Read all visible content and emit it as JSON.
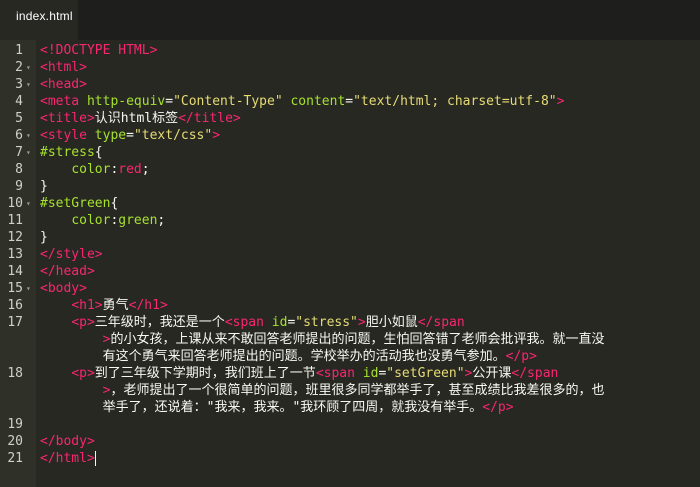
{
  "tab": {
    "title": "index.html"
  },
  "lines": [
    {
      "n": "1",
      "fold": false,
      "parts": [
        [
          "t",
          "<!DOCTYPE HTML>"
        ]
      ]
    },
    {
      "n": "2",
      "fold": true,
      "parts": [
        [
          "t",
          "<html>"
        ]
      ]
    },
    {
      "n": "3",
      "fold": true,
      "parts": [
        [
          "t",
          "<head>"
        ]
      ]
    },
    {
      "n": "4",
      "fold": false,
      "parts": [
        [
          "t",
          "<meta "
        ],
        [
          "a",
          "http-equiv"
        ],
        [
          "w",
          "="
        ],
        [
          "s",
          "\"Content-Type\""
        ],
        [
          "w",
          " "
        ],
        [
          "a",
          "content"
        ],
        [
          "w",
          "="
        ],
        [
          "s",
          "\"text/html; charset=utf-8\""
        ],
        [
          "t",
          ">"
        ]
      ]
    },
    {
      "n": "5",
      "fold": false,
      "parts": [
        [
          "t",
          "<title>"
        ],
        [
          "w",
          "认识html标签"
        ],
        [
          "t",
          "</title>"
        ]
      ]
    },
    {
      "n": "6",
      "fold": true,
      "parts": [
        [
          "t",
          "<style "
        ],
        [
          "a",
          "type"
        ],
        [
          "w",
          "="
        ],
        [
          "s",
          "\"text/css\""
        ],
        [
          "t",
          ">"
        ]
      ]
    },
    {
      "n": "7",
      "fold": true,
      "parts": [
        [
          "a",
          "#stress"
        ],
        [
          "w",
          "{"
        ]
      ]
    },
    {
      "n": "8",
      "fold": false,
      "parts": [
        [
          "w",
          "    "
        ],
        [
          "a",
          "color"
        ],
        [
          "w",
          ":"
        ],
        [
          "t",
          "red"
        ],
        [
          "w",
          ";"
        ]
      ]
    },
    {
      "n": "9",
      "fold": false,
      "parts": [
        [
          "w",
          "}"
        ]
      ]
    },
    {
      "n": "10",
      "fold": true,
      "parts": [
        [
          "a",
          "#setGreen"
        ],
        [
          "w",
          "{"
        ]
      ]
    },
    {
      "n": "11",
      "fold": false,
      "parts": [
        [
          "w",
          "    "
        ],
        [
          "a",
          "color"
        ],
        [
          "w",
          ":"
        ],
        [
          "a",
          "green"
        ],
        [
          "w",
          ";"
        ]
      ]
    },
    {
      "n": "12",
      "fold": false,
      "parts": [
        [
          "w",
          "}"
        ]
      ]
    },
    {
      "n": "13",
      "fold": false,
      "parts": [
        [
          "t",
          "</style>"
        ]
      ]
    },
    {
      "n": "14",
      "fold": false,
      "parts": [
        [
          "t",
          "</head>"
        ]
      ]
    },
    {
      "n": "15",
      "fold": true,
      "parts": [
        [
          "t",
          "<body>"
        ]
      ]
    },
    {
      "n": "16",
      "fold": false,
      "parts": [
        [
          "w",
          "    "
        ],
        [
          "t",
          "<h1>"
        ],
        [
          "w",
          "勇气"
        ],
        [
          "t",
          "</h1>"
        ]
      ]
    },
    {
      "n": "17",
      "fold": false,
      "parts": [
        [
          "w",
          "    "
        ],
        [
          "t",
          "<p>"
        ],
        [
          "w",
          "三年级时，我还是一个"
        ],
        [
          "t",
          "<span "
        ],
        [
          "a",
          "id"
        ],
        [
          "w",
          "="
        ],
        [
          "s",
          "\"stress\""
        ],
        [
          "t",
          ">"
        ],
        [
          "w",
          "胆小如鼠"
        ],
        [
          "t",
          "</span"
        ]
      ]
    },
    {
      "n": "",
      "fold": false,
      "parts": [
        [
          "w",
          "        "
        ],
        [
          "t",
          ">"
        ],
        [
          "w",
          "的小女孩，上课从来不敢回答老师提出的问题，生怕回答错了老师会批评我。就一直没"
        ]
      ]
    },
    {
      "n": "",
      "fold": false,
      "parts": [
        [
          "w",
          "        有这个勇气来回答老师提出的问题。学校举办的活动我也没勇气参加。"
        ],
        [
          "t",
          "</p>"
        ]
      ]
    },
    {
      "n": "18",
      "fold": false,
      "parts": [
        [
          "w",
          "    "
        ],
        [
          "t",
          "<p>"
        ],
        [
          "w",
          "到了三年级下学期时，我们班上了一节"
        ],
        [
          "t",
          "<span "
        ],
        [
          "a",
          "id"
        ],
        [
          "w",
          "="
        ],
        [
          "s",
          "\"setGreen\""
        ],
        [
          "t",
          ">"
        ],
        [
          "w",
          "公开课"
        ],
        [
          "t",
          "</span"
        ]
      ]
    },
    {
      "n": "",
      "fold": false,
      "parts": [
        [
          "w",
          "        "
        ],
        [
          "t",
          ">"
        ],
        [
          "w",
          "，老师提出了一个很简单的问题，班里很多同学都举手了，甚至成绩比我差很多的，也"
        ]
      ]
    },
    {
      "n": "",
      "fold": false,
      "parts": [
        [
          "w",
          "        举手了，还说着：\"我来，我来。\"我环顾了四周，就我没有举手。"
        ],
        [
          "t",
          "</p>"
        ]
      ]
    },
    {
      "n": "19",
      "fold": false,
      "parts": []
    },
    {
      "n": "20",
      "fold": false,
      "parts": [
        [
          "t",
          "</body>"
        ]
      ]
    },
    {
      "n": "21",
      "fold": false,
      "parts": [
        [
          "t",
          "</html>"
        ]
      ]
    }
  ]
}
